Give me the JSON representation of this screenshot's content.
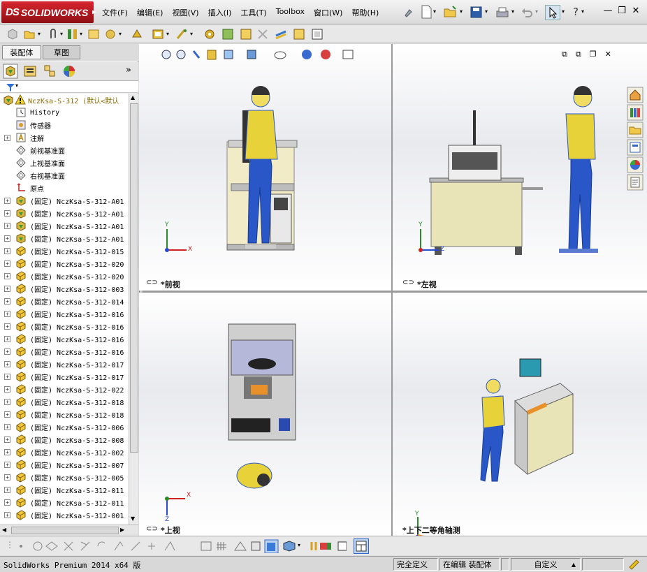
{
  "app": {
    "brand": "SOLIDWORKS",
    "brand_prefix": "DS"
  },
  "menu": {
    "items": [
      "文件(F)",
      "编辑(E)",
      "视图(V)",
      "插入(I)",
      "工具(T)",
      "Toolbox",
      "窗口(W)",
      "帮助(H)"
    ]
  },
  "manager_tabs": [
    "装配体",
    "草图"
  ],
  "tree": {
    "root": "NczKsa-S-312  (默认<默认",
    "items": [
      {
        "label": "History",
        "icon": "history-icon",
        "expand": false
      },
      {
        "label": "传感器",
        "icon": "sensor-icon",
        "expand": false
      },
      {
        "label": "注解",
        "icon": "annotation-icon",
        "expand": true
      },
      {
        "label": "前视基准面",
        "icon": "plane-icon",
        "expand": false
      },
      {
        "label": "上视基准面",
        "icon": "plane-icon",
        "expand": false
      },
      {
        "label": "右视基准面",
        "icon": "plane-icon",
        "expand": false
      },
      {
        "label": "原点",
        "icon": "origin-icon",
        "expand": false
      },
      {
        "label": "(固定) NczKsa-S-312-A01",
        "icon": "subassembly-icon",
        "expand": true
      },
      {
        "label": "(固定) NczKsa-S-312-A01",
        "icon": "subassembly-icon",
        "expand": true
      },
      {
        "label": "(固定) NczKsa-S-312-A01",
        "icon": "subassembly-icon",
        "expand": true
      },
      {
        "label": "(固定) NczKsa-S-312-A01",
        "icon": "subassembly-icon",
        "expand": true
      },
      {
        "label": "(固定) NczKsa-S-312-015",
        "icon": "part-icon",
        "expand": true
      },
      {
        "label": "(固定) NczKsa-S-312-020",
        "icon": "part-icon",
        "expand": true
      },
      {
        "label": "(固定) NczKsa-S-312-020",
        "icon": "part-icon",
        "expand": true
      },
      {
        "label": "(固定) NczKsa-S-312-003",
        "icon": "part-icon",
        "expand": true
      },
      {
        "label": "(固定) NczKsa-S-312-014",
        "icon": "part-icon",
        "expand": true
      },
      {
        "label": "(固定) NczKsa-S-312-016",
        "icon": "part-icon",
        "expand": true
      },
      {
        "label": "(固定) NczKsa-S-312-016",
        "icon": "part-icon",
        "expand": true
      },
      {
        "label": "(固定) NczKsa-S-312-016",
        "icon": "part-icon",
        "expand": true
      },
      {
        "label": "(固定) NczKsa-S-312-016",
        "icon": "part-icon",
        "expand": true
      },
      {
        "label": "(固定) NczKsa-S-312-017",
        "icon": "part-icon",
        "expand": true
      },
      {
        "label": "(固定) NczKsa-S-312-017",
        "icon": "part-icon",
        "expand": true
      },
      {
        "label": "(固定) NczKsa-S-312-022",
        "icon": "part-icon",
        "expand": true
      },
      {
        "label": "(固定) NczKsa-S-312-018",
        "icon": "part-icon",
        "expand": true
      },
      {
        "label": "(固定) NczKsa-S-312-018",
        "icon": "part-icon",
        "expand": true
      },
      {
        "label": "(固定) NczKsa-S-312-006",
        "icon": "part-icon",
        "expand": true
      },
      {
        "label": "(固定) NczKsa-S-312-008",
        "icon": "part-icon",
        "expand": true
      },
      {
        "label": "(固定) NczKsa-S-312-002",
        "icon": "part-icon",
        "expand": true
      },
      {
        "label": "(固定) NczKsa-S-312-007",
        "icon": "part-icon",
        "expand": true
      },
      {
        "label": "(固定) NczKsa-S-312-005",
        "icon": "part-icon",
        "expand": true
      },
      {
        "label": "(固定) NczKsa-S-312-011",
        "icon": "part-icon",
        "expand": true
      },
      {
        "label": "(固定) NczKsa-S-312-011",
        "icon": "part-icon",
        "expand": true
      },
      {
        "label": "(固定) NczKsa-S-312-001",
        "icon": "part-icon",
        "expand": true
      }
    ]
  },
  "viewports": {
    "front": {
      "label": "*前视"
    },
    "left": {
      "label": "*左视"
    },
    "top": {
      "label": "*上视"
    },
    "iso": {
      "label": "*上下二等角轴测"
    }
  },
  "axes": {
    "x": "X",
    "y": "Y",
    "z": "Z"
  },
  "status": {
    "product": "SolidWorks Premium 2014 x64 版",
    "constraint": "完全定义",
    "mode": "在编辑 装配体",
    "units": "自定义"
  },
  "colors": {
    "brand_red": "#c8202a",
    "worker_yellow": "#e8d23a",
    "worker_blue": "#2a57c8",
    "table_beige": "#e9e4b8",
    "frame_gray": "#b9b9b9"
  }
}
